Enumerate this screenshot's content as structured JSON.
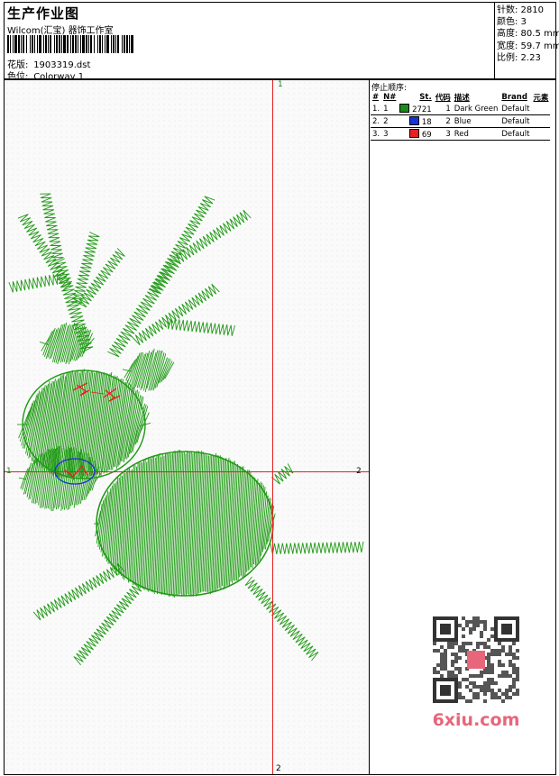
{
  "header": {
    "title": "生产作业图",
    "company": "Wilcom(汇宝) 器饰工作室",
    "design_label": "花版:",
    "design_value": "1903319.dst",
    "colorway_label": "色位:",
    "colorway_value": "Colorway 1"
  },
  "stats": {
    "stitches": "针数: 2810",
    "colors": "颜色: 3",
    "height": "高度: 80.5 mm",
    "width": "宽度: 59.7 mm",
    "ratio": "比例: 2.23"
  },
  "canvas": {
    "axis_labels": {
      "top": "1",
      "left": "1",
      "right": "2",
      "bottom": "2"
    }
  },
  "stop_sequence": {
    "title": "停止顺序:",
    "headers": [
      "#",
      "N#",
      "St.",
      "代码",
      "描述",
      "Brand",
      "元素"
    ],
    "rows": [
      {
        "num": "1.",
        "n": "1",
        "color": "#1a8a1a",
        "st": "2721",
        "code": "1",
        "desc": "Dark Green",
        "brand": "Default"
      },
      {
        "num": "2.",
        "n": "2",
        "color": "#1633d8",
        "st": "18",
        "code": "2",
        "desc": "Blue",
        "brand": "Default"
      },
      {
        "num": "3.",
        "n": "3",
        "color": "#e82020",
        "st": "69",
        "code": "3",
        "desc": "Red",
        "brand": "Default"
      }
    ]
  },
  "watermark": {
    "text": "6xiu.com"
  }
}
